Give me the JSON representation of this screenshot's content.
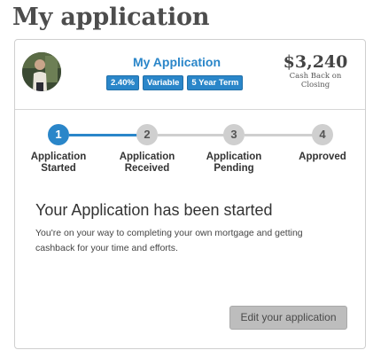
{
  "page": {
    "title": "My application"
  },
  "application": {
    "name": "My Application",
    "tags": [
      "2.40%",
      "Variable",
      "5 Year Term"
    ],
    "cash_back_amount": "$3,240",
    "cash_back_label": "Cash Back on Closing"
  },
  "stepper": {
    "current_step": 1,
    "steps": [
      {
        "number": "1",
        "label": "Application Started"
      },
      {
        "number": "2",
        "label": "Application Received"
      },
      {
        "number": "3",
        "label": "Application Pending"
      },
      {
        "number": "4",
        "label": "Approved"
      }
    ]
  },
  "status": {
    "heading": "Your Application has been started",
    "message": "You're on your way to completing your own mortgage and getting cashback for your time and efforts."
  },
  "actions": {
    "edit_label": "Edit your application"
  },
  "colors": {
    "accent": "#2a86c9",
    "inactive": "#cfcfcf",
    "button": "#bdbdbd"
  }
}
